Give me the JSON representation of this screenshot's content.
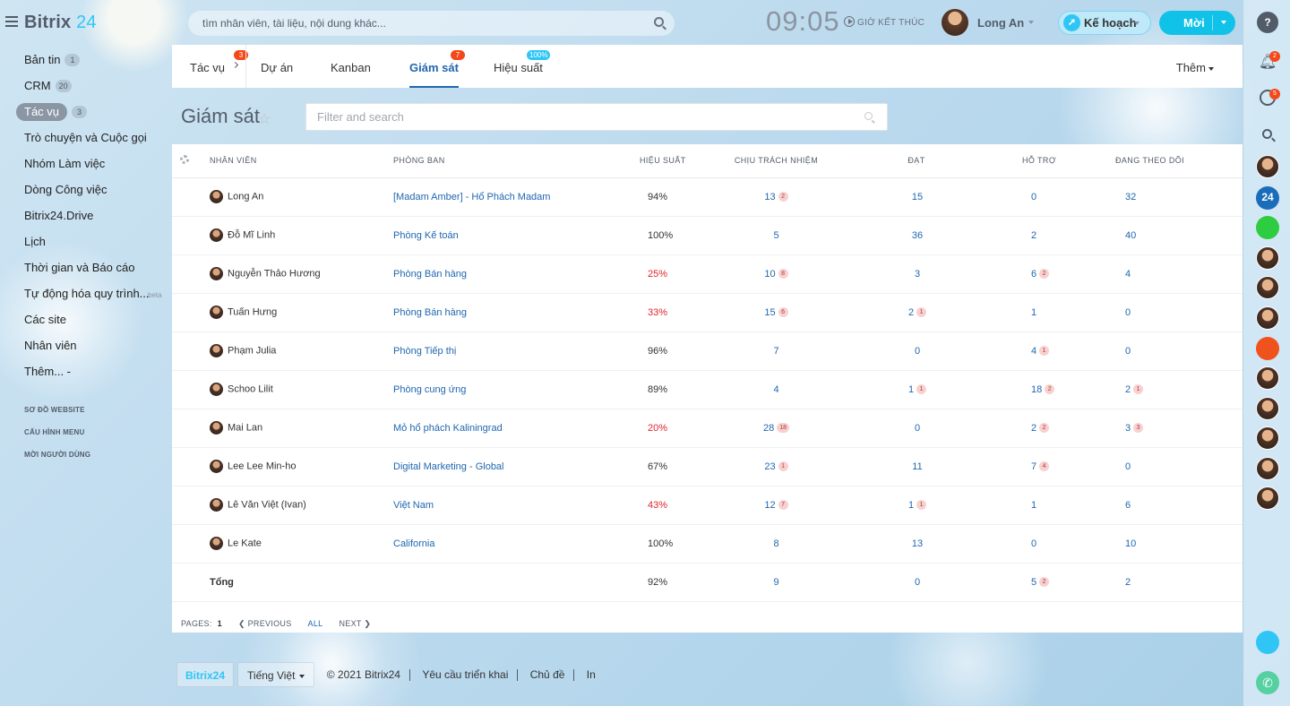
{
  "app": {
    "brand": "Bitrix",
    "brand_num": "24"
  },
  "header": {
    "search_placeholder": "tìm nhân viên, tài liệu, nội dung khác...",
    "clock": "09:05",
    "end_day": "GIỜ KẾT THÚC",
    "user_name": "Long An",
    "plan_label": "Kế hoạch",
    "invite_label": "Mời"
  },
  "sidebar": {
    "items": [
      {
        "label": "Bản tin",
        "count": "1"
      },
      {
        "label": "CRM",
        "count": "20"
      },
      {
        "label": "Tác vụ",
        "count": "3",
        "active": true
      },
      {
        "label": "Trò chuyện và Cuộc gọi"
      },
      {
        "label": "Nhóm Làm việc"
      },
      {
        "label": "Dòng Công việc"
      },
      {
        "label": "Bitrix24.Drive"
      },
      {
        "label": "Lịch"
      },
      {
        "label": "Thời gian và Báo cáo"
      },
      {
        "label": "Tự động hóa quy trình...",
        "tag": "beta"
      },
      {
        "label": "Các site"
      },
      {
        "label": "Nhân viên"
      },
      {
        "label": "Thêm... -"
      }
    ],
    "small_links": [
      "SƠ ĐỒ WEBSITE",
      "CẤU HÌNH MENU",
      "MỜI NGƯỜI DÙNG"
    ]
  },
  "tabs": {
    "items": [
      {
        "label": "Tác vụ",
        "badge": "3"
      },
      {
        "label": "Dự án"
      },
      {
        "label": "Kanban"
      },
      {
        "label": "Giám sát",
        "badge": "7"
      },
      {
        "label": "Hiệu suất",
        "badge": "100%"
      }
    ],
    "more": "Thêm"
  },
  "page": {
    "title": "Giám sát",
    "filter_placeholder": "Filter and search"
  },
  "grid": {
    "columns": [
      "NHÂN VIÊN",
      "PHÒNG BAN",
      "HIỆU SUẤT",
      "CHỊU TRÁCH NHIỆM",
      "ĐẠT",
      "HỖ TRỢ",
      "ĐANG THEO DÕI"
    ],
    "rows": [
      {
        "name": "Long An",
        "dept": "[Madam Amber] - Hổ Phách Madam",
        "eff": "94%",
        "resp": "13",
        "resp_b": "2",
        "done": "15",
        "done_b": "",
        "help": "0",
        "help_b": "",
        "watch": "32",
        "watch_b": "",
        "low": false
      },
      {
        "name": "Đỗ Mĩ Linh",
        "dept": "Phòng Kế toán",
        "eff": "100%",
        "resp": "5",
        "resp_b": "",
        "done": "36",
        "done_b": "",
        "help": "2",
        "help_b": "",
        "watch": "40",
        "watch_b": "",
        "low": false
      },
      {
        "name": "Nguyễn Thảo Hương",
        "dept": "Phòng Bán hàng",
        "eff": "25%",
        "resp": "10",
        "resp_b": "8",
        "done": "3",
        "done_b": "",
        "help": "6",
        "help_b": "2",
        "watch": "4",
        "watch_b": "",
        "low": true
      },
      {
        "name": "Tuấn Hưng",
        "dept": "Phòng Bán hàng",
        "eff": "33%",
        "resp": "15",
        "resp_b": "6",
        "done": "2",
        "done_b": "1",
        "help": "1",
        "help_b": "",
        "watch": "0",
        "watch_b": "",
        "low": true
      },
      {
        "name": "Phạm Julia",
        "dept": "Phòng Tiếp thị",
        "eff": "96%",
        "resp": "7",
        "resp_b": "",
        "done": "0",
        "done_b": "",
        "help": "4",
        "help_b": "1",
        "watch": "0",
        "watch_b": "",
        "low": false
      },
      {
        "name": "Schoo Lilit",
        "dept": "Phòng cung ứng",
        "eff": "89%",
        "resp": "4",
        "resp_b": "",
        "done": "1",
        "done_b": "1",
        "help": "18",
        "help_b": "2",
        "watch": "2",
        "watch_b": "1",
        "low": false
      },
      {
        "name": "Mai Lan",
        "dept": "Mỏ hổ phách Kaliningrad",
        "eff": "20%",
        "resp": "28",
        "resp_b": "18",
        "done": "0",
        "done_b": "",
        "help": "2",
        "help_b": "2",
        "watch": "3",
        "watch_b": "3",
        "low": true
      },
      {
        "name": "Lee Lee Min-ho",
        "dept": "Digital Marketing - Global",
        "eff": "67%",
        "resp": "23",
        "resp_b": "1",
        "done": "11",
        "done_b": "",
        "help": "7",
        "help_b": "4",
        "watch": "0",
        "watch_b": "",
        "low": false
      },
      {
        "name": "Lê Văn Việt (Ivan)",
        "dept": "Việt Nam",
        "eff": "43%",
        "resp": "12",
        "resp_b": "7",
        "done": "1",
        "done_b": "1",
        "help": "1",
        "help_b": "",
        "watch": "6",
        "watch_b": "",
        "low": true
      },
      {
        "name": "Le Kate",
        "dept": "California",
        "eff": "100%",
        "resp": "8",
        "resp_b": "",
        "done": "13",
        "done_b": "",
        "help": "0",
        "help_b": "",
        "watch": "10",
        "watch_b": "",
        "low": false
      }
    ],
    "total": {
      "label": "Tổng",
      "eff": "92%",
      "resp": "9",
      "done": "0",
      "help": "5",
      "help_b": "2",
      "watch": "2"
    }
  },
  "pager": {
    "pages_label": "PAGES:",
    "page": "1",
    "prev": "PREVIOUS",
    "all": "ALL",
    "next": "NEXT"
  },
  "footer": {
    "logo": "Bitrix24",
    "lang": "Tiếng Việt",
    "copyright": "© 2021 Bitrix24",
    "links": [
      "Yêu cầu triển khai",
      "Chủ đề",
      "In"
    ]
  },
  "rightbar": {
    "notif_count": "2",
    "chat_count": "5",
    "b24_label": "24"
  },
  "colors": {
    "accent": "#2067b0",
    "badge_red": "#f54819",
    "cyan": "#2fc6f6",
    "low_eff": "#e0242d"
  }
}
